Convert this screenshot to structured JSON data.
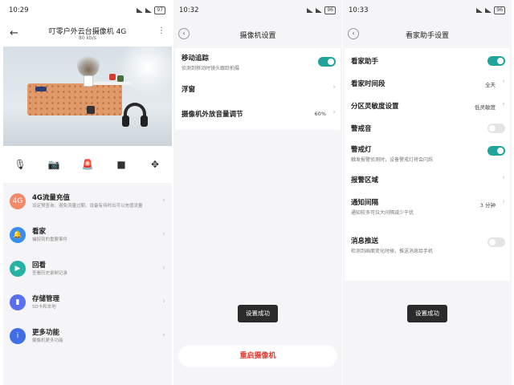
{
  "panel1": {
    "status": {
      "time": "10:29",
      "battery": "97"
    },
    "title": "叮零户外云台摄像机 4G",
    "speed": "80 kb/s",
    "menu": [
      {
        "title": "4G流量充值",
        "subtitle": "设定预查询、避免流量过期、设备有待时出可以充值流量",
        "color": "#f3896a",
        "icon": "sim-card-icon"
      },
      {
        "title": "看家",
        "subtitle": "捕捉到的重要事件",
        "color": "#3a8df0",
        "icon": "bell-icon"
      },
      {
        "title": "回看",
        "subtitle": "查看历史录制记录",
        "color": "#27b3a3",
        "icon": "playback-icon"
      },
      {
        "title": "存储管理",
        "subtitle": "SD卡和本地",
        "color": "#5a6ef0",
        "icon": "storage-icon"
      },
      {
        "title": "更多功能",
        "subtitle": "摄像机更多功能",
        "color": "#3f6ee8",
        "icon": "info-icon"
      }
    ],
    "toolbar": [
      "microphone-icon",
      "camera-icon",
      "alarm-icon",
      "video-record-icon",
      "ptz-control-icon"
    ]
  },
  "panel2": {
    "status": {
      "time": "10:32",
      "battery": "96"
    },
    "title": "摄像机设置",
    "rows": {
      "tracking": {
        "title": "移动追踪",
        "subtitle": "侦测到移动时镜头跟踪拍摄",
        "on": true
      },
      "float": {
        "title": "浮窗"
      },
      "volume": {
        "title": "摄像机外放音量调节",
        "value": "60%"
      }
    },
    "toast": "设置成功",
    "restart": "重启摄像机"
  },
  "panel3": {
    "status": {
      "time": "10:33",
      "battery": "96"
    },
    "title": "看家助手设置",
    "rows": {
      "assistant": {
        "title": "看家助手",
        "on": true
      },
      "period": {
        "title": "看家时间段",
        "value": "全天"
      },
      "sensitivity": {
        "title": "分区灵敏度设置",
        "value": "低灵敏度"
      },
      "alarm_sound": {
        "title": "警戒音",
        "on": false
      },
      "alarm_light": {
        "title": "警戒灯",
        "subtitle": "触发报警侦测时，设备警戒灯将会闪烁",
        "on": true
      },
      "zone": {
        "title": "报警区域"
      },
      "interval": {
        "title": "通知间隔",
        "subtitle": "通知较多可拉大间隔减少干扰",
        "value": "3 分钟"
      },
      "push": {
        "title": "消息推送",
        "subtitle": "检测到画面变化时候，推送消息给手机",
        "on": false
      }
    },
    "toast": "设置成功"
  }
}
